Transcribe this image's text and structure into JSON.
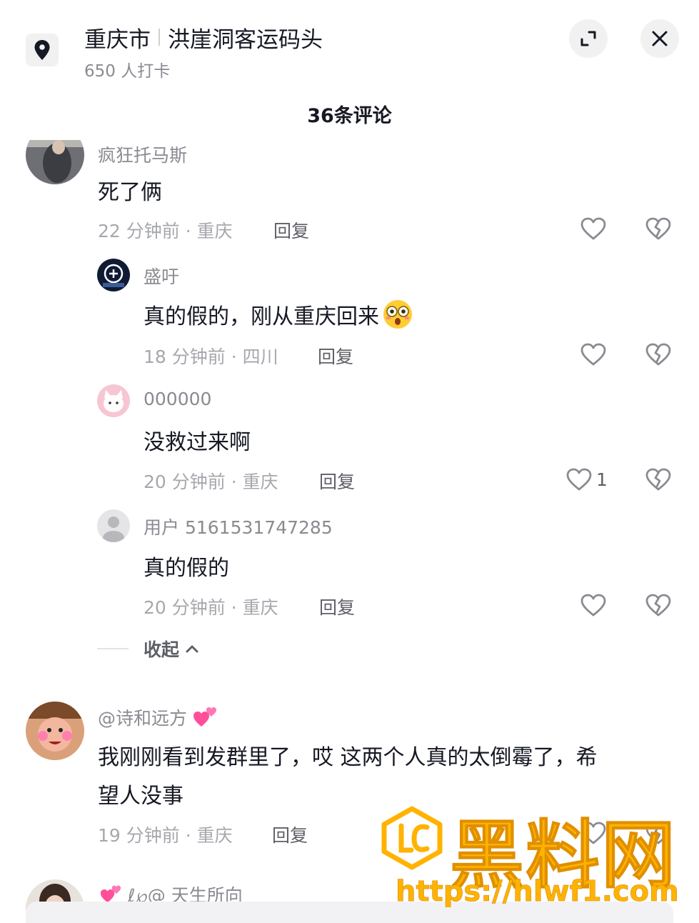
{
  "header": {
    "city": "重庆市",
    "place": "洪崖洞客运码头",
    "checkins": "650 人打卡",
    "icons": {
      "location": "location-pin-icon",
      "expand": "expand-icon",
      "close": "close-icon"
    }
  },
  "comments_title": "36条评论",
  "comments": [
    {
      "user": "疯狂托马斯",
      "text": "死了俩",
      "meta": "22 分钟前 · 重庆",
      "reply": "回复"
    },
    {
      "user": "盛吁",
      "text": "真的假的，刚从重庆回来",
      "meta": "18 分钟前 · 四川",
      "reply": "回复"
    },
    {
      "user": "000000",
      "text": "没救过来啊",
      "meta": "20 分钟前 · 重庆",
      "reply": "回复",
      "likes": "1"
    },
    {
      "user": "用户 5161531747285",
      "text": "真的假的",
      "meta": "20 分钟前 · 重庆",
      "reply": "回复"
    },
    {
      "user": "@诗和远方",
      "text_line1": "我刚刚看到发群里了，哎 这两个人真的太倒霉了，希",
      "text_line2": "望人没事",
      "meta": "19 分钟前 · 重庆",
      "reply": "回复"
    },
    {
      "user": "ℓ℘@ 天生所向"
    }
  ],
  "collapse": "收起",
  "watermark": {
    "text": "黑料网",
    "url": "https://hlwf1.com"
  },
  "colors": {
    "accent": "#ffb300",
    "text": "#161823",
    "muted": "#8a8b91"
  }
}
